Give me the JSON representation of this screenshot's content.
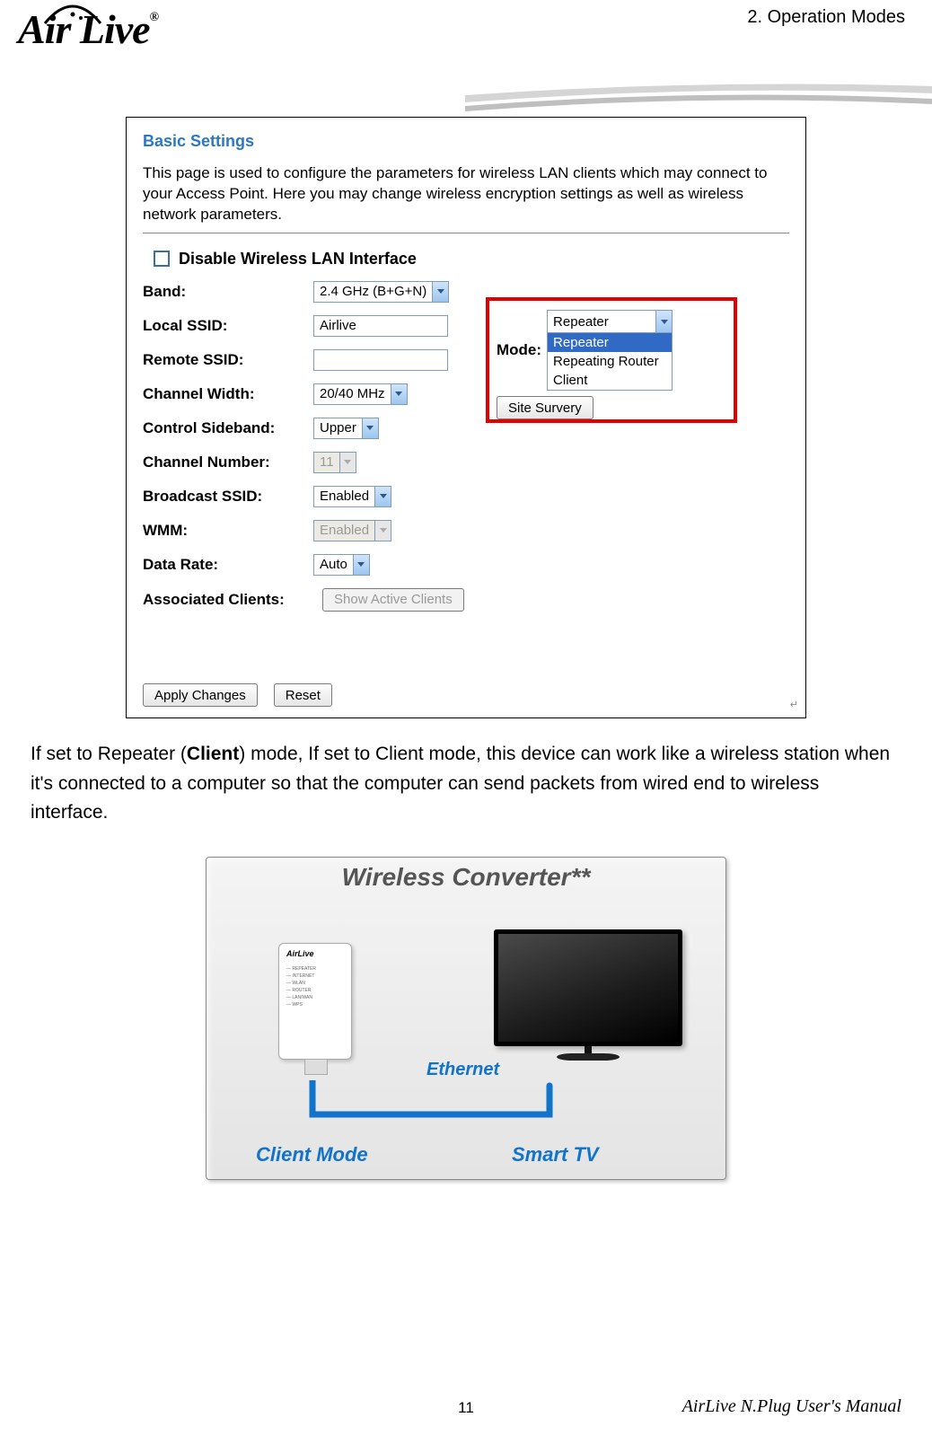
{
  "header": {
    "chapter": "2. Operation Modes",
    "logo_text": "Air Live",
    "logo_reg": "®"
  },
  "settings": {
    "title": "Basic Settings",
    "description": "This page is used to configure the parameters for wireless LAN clients which may connect to your Access Point. Here you may change wireless encryption settings as well as wireless network parameters.",
    "disable_label": "Disable Wireless LAN Interface",
    "band": {
      "label": "Band:",
      "value": "2.4 GHz (B+G+N)"
    },
    "local_ssid": {
      "label": "Local SSID:",
      "value": "Airlive"
    },
    "remote_ssid": {
      "label": "Remote SSID:",
      "value": ""
    },
    "channel_width": {
      "label": "Channel Width:",
      "value": "20/40 MHz"
    },
    "control_sideband": {
      "label": "Control Sideband:",
      "value": "Upper"
    },
    "channel_number": {
      "label": "Channel Number:",
      "value": "11"
    },
    "broadcast_ssid": {
      "label": "Broadcast SSID:",
      "value": "Enabled"
    },
    "wmm": {
      "label": "WMM:",
      "value": "Enabled"
    },
    "data_rate": {
      "label": "Data Rate:",
      "value": "Auto"
    },
    "associated": {
      "label": "Associated Clients:",
      "button": "Show Active Clients"
    },
    "mode": {
      "label": "Mode:",
      "selected": "Repeater",
      "options": [
        "Repeater",
        "Repeating Router",
        "Client"
      ]
    },
    "site_survey": "Site Survery",
    "apply": "Apply Changes",
    "reset": "Reset"
  },
  "body": {
    "text_pre": "If set to Repeater (",
    "text_bold": "Client",
    "text_post": ") mode, If set to Client mode, this device can work like a wireless station when it's connected to a computer so that the computer can send packets from wired end to wireless interface."
  },
  "diagram": {
    "title": "Wireless Converter**",
    "ethernet": "Ethernet",
    "client_mode": "Client Mode",
    "smart_tv": "Smart TV",
    "plug_logo": "AirLive"
  },
  "footer": {
    "page": "11",
    "manual": "AirLive N.Plug User's Manual"
  }
}
